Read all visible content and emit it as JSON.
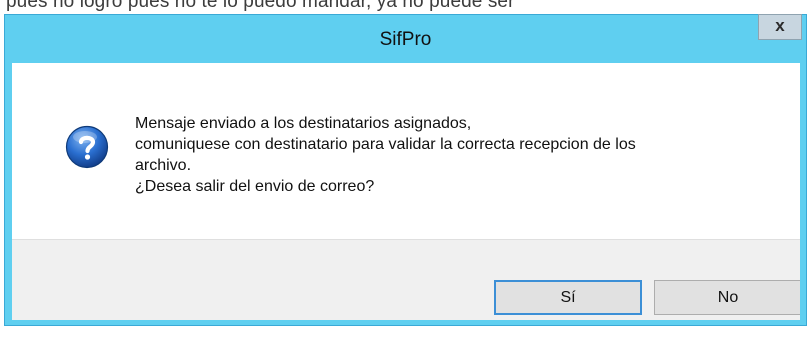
{
  "backdrop": {
    "text": "pues no logro pues no te lo puedo mandar, ya no puede ser"
  },
  "dialog": {
    "title": "SifPro",
    "close_label": "x",
    "message_lines": [
      "Mensaje enviado a los destinatarios asignados,",
      "comuniquese con destinatario para validar la correcta recepcion de los",
      "archivo.",
      "¿Desea salir del envio de correo?"
    ],
    "icon": "question-icon",
    "buttons": {
      "yes_label": "Sí",
      "no_label": "No"
    }
  },
  "colors": {
    "titlebar": "#5fcff0",
    "footer": "#f0f0f0",
    "icon_blue": "#1f5fb8",
    "focus_border": "#3c8fd6"
  }
}
